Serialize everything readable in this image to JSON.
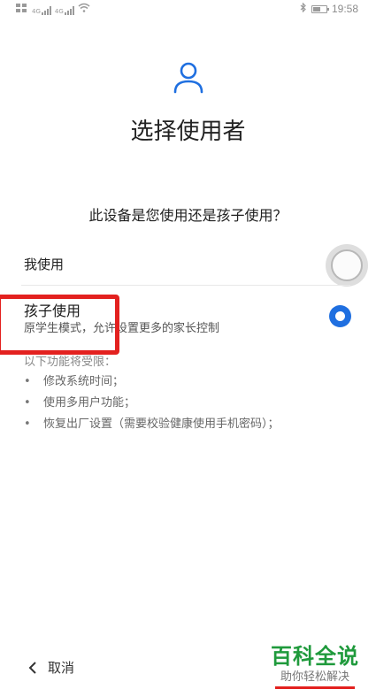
{
  "status_bar": {
    "net_labels": [
      "4G",
      "4G"
    ],
    "time": "19:58",
    "battery_level": 0.55
  },
  "header": {
    "title": "选择使用者"
  },
  "question": "此设备是您使用还是孩子使用？",
  "options": [
    {
      "label": "我使用",
      "selected": false
    },
    {
      "label": "孩子使用",
      "description": "原学生模式，允许设置更多的家长控制",
      "selected": true
    }
  ],
  "restrictions": {
    "title": "以下功能将受限：",
    "items": [
      "修改系统时间；",
      "使用多用户功能；",
      "恢复出厂设置（需要校验健康使用手机密码）；"
    ]
  },
  "footer": {
    "cancel_label": "取消"
  },
  "watermark": {
    "main": "百科全说",
    "sub": "助你轻松解决"
  },
  "colors": {
    "accent": "#1f6fe0",
    "highlight": "#e3211f",
    "watermark_green": "#1f9a3c"
  }
}
